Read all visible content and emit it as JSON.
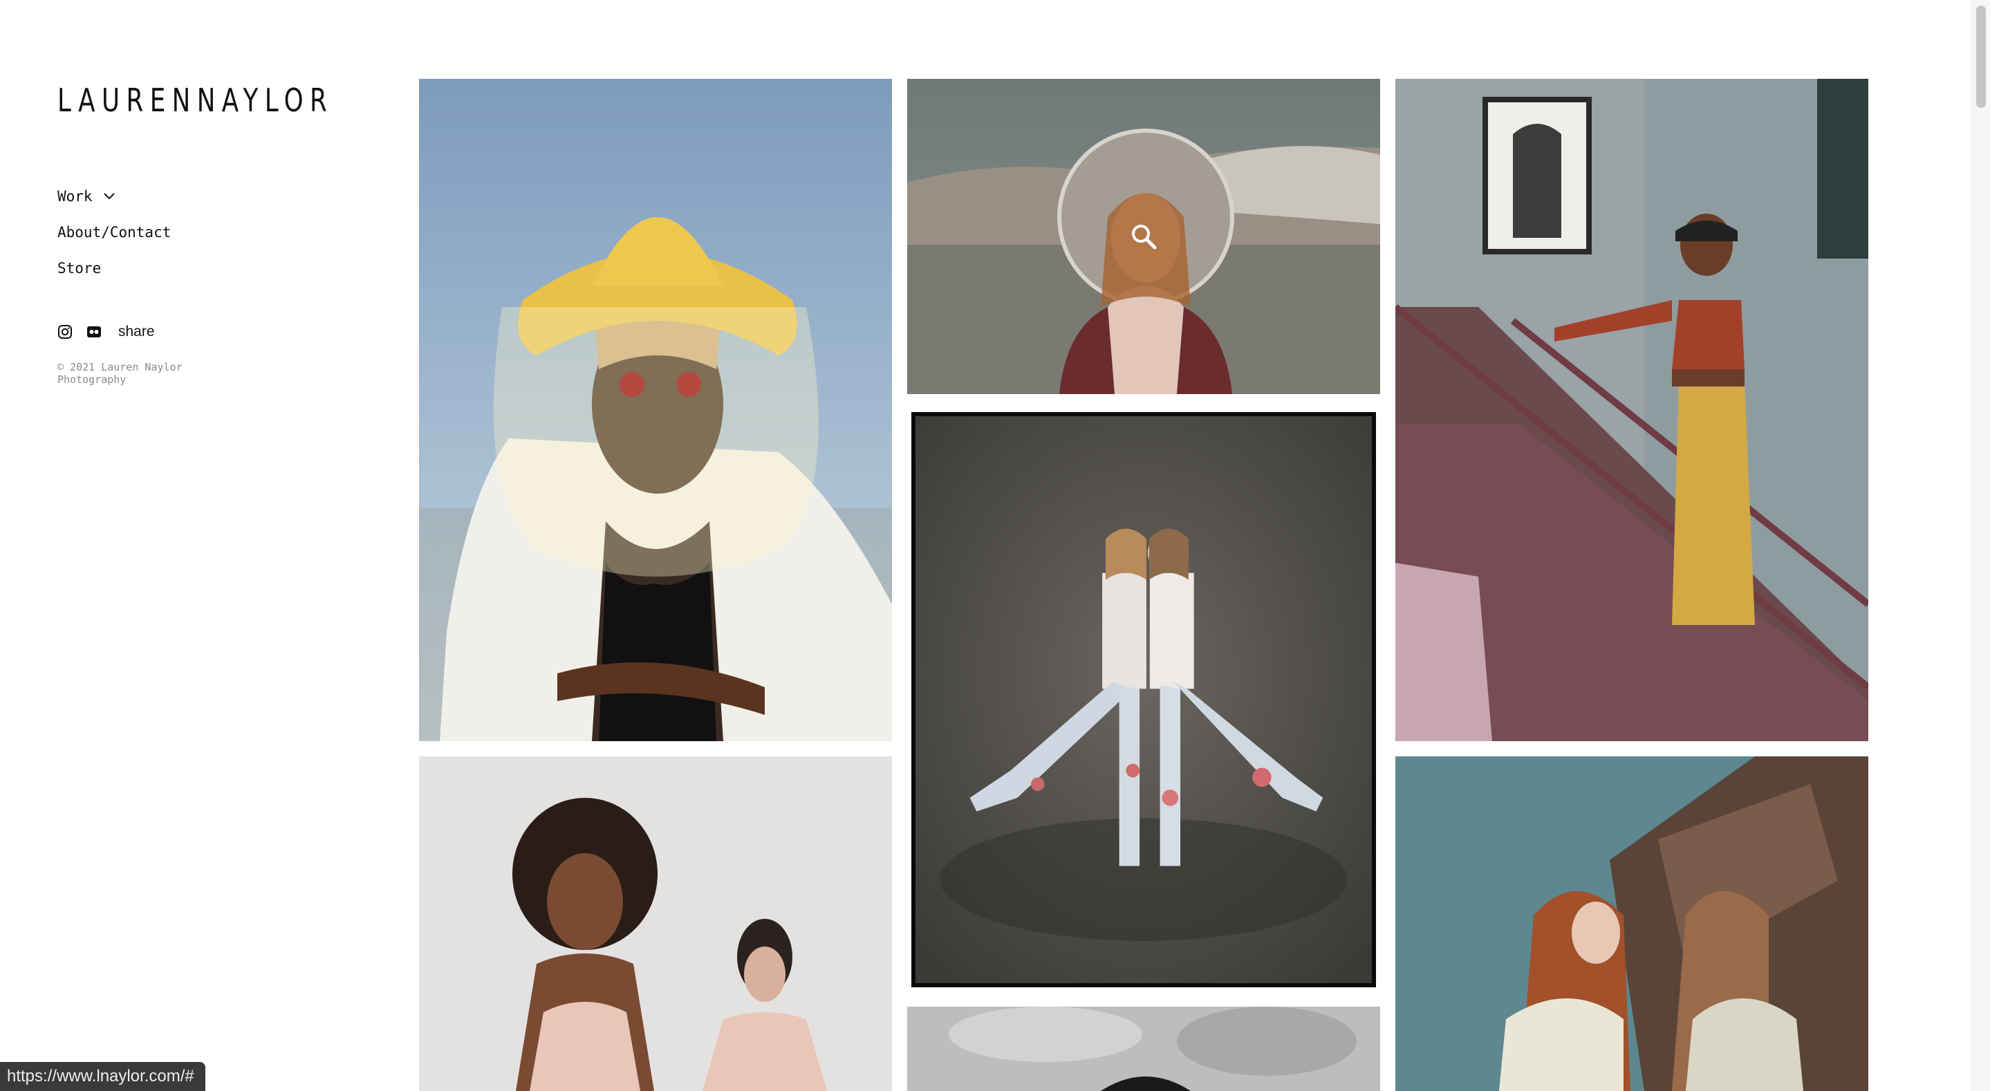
{
  "site": {
    "logo": "LAURENNAYLOR"
  },
  "nav": {
    "items": [
      {
        "label": "Work",
        "has_dropdown": true,
        "icon": "chevron-down-icon"
      },
      {
        "label": "About/Contact"
      },
      {
        "label": "Store"
      }
    ]
  },
  "social": {
    "icons": [
      "instagram-icon",
      "flickr-icon"
    ],
    "share_label": "share"
  },
  "footer": {
    "copyright": "© 2021 Lauren Naylor Photography"
  },
  "gallery": {
    "tiles": [
      {
        "subject": "woman-yellow-hat"
      },
      {
        "subject": "woman-with-mirror-desert",
        "hover_icon": "search-icon"
      },
      {
        "subject": "two-women-floral-pants"
      },
      {
        "subject": "woman-on-staircase"
      },
      {
        "subject": "two-women-outdoors"
      },
      {
        "subject": "black-and-white-portrait"
      },
      {
        "subject": "mirrored-redhead"
      }
    ]
  },
  "status": {
    "url": "https://www.lnaylor.com/#"
  },
  "colors": {
    "background": "#ffffff",
    "text": "#111111",
    "muted": "#8a8a8a",
    "status_bg": "#3a3a3a"
  }
}
